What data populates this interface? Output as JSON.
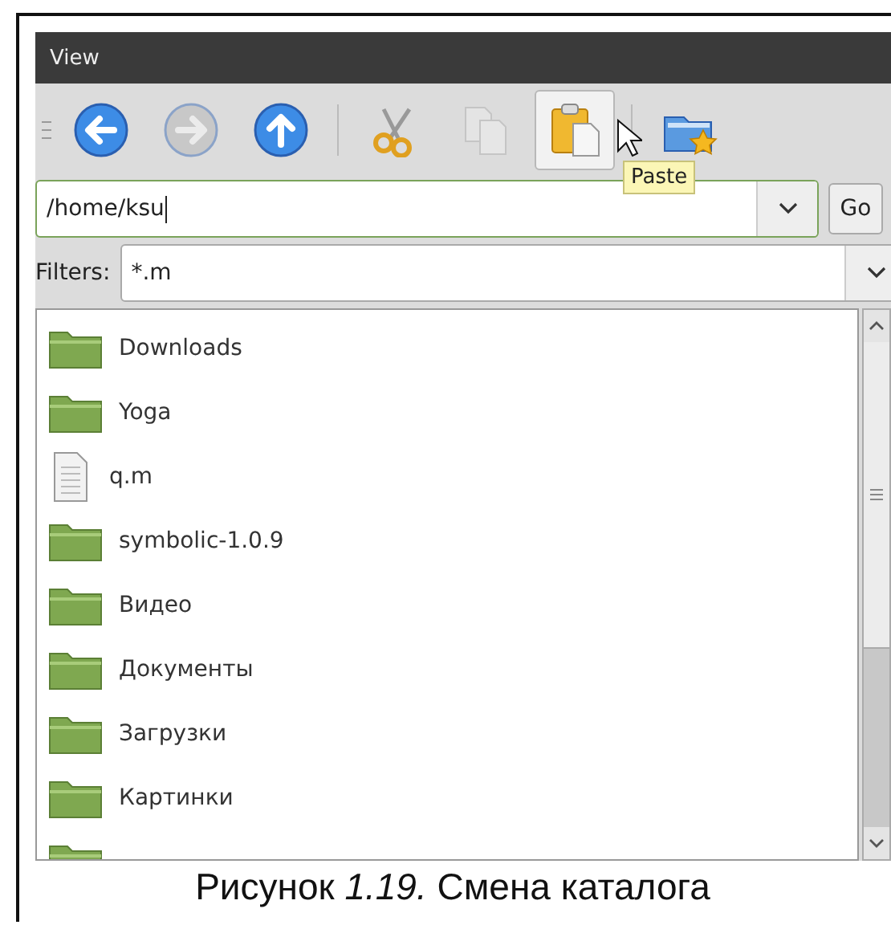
{
  "window": {
    "title": "View"
  },
  "toolbar": [
    {
      "kind": "back",
      "disabled": false,
      "hovered": false
    },
    {
      "kind": "forward",
      "disabled": true,
      "hovered": false
    },
    {
      "kind": "up",
      "disabled": false,
      "hovered": false
    },
    {
      "kind": "separator"
    },
    {
      "kind": "cut",
      "disabled": false,
      "hovered": false
    },
    {
      "kind": "copy",
      "disabled": true,
      "hovered": false
    },
    {
      "kind": "paste",
      "disabled": false,
      "hovered": true
    },
    {
      "kind": "separator"
    },
    {
      "kind": "bookmark",
      "disabled": false,
      "hovered": false
    }
  ],
  "tooltip": "Paste",
  "path": {
    "value": "/home/ksu",
    "focused": true,
    "button": "Go"
  },
  "filter": {
    "label": "Filters:",
    "value": "*.m"
  },
  "files": [
    {
      "name": "Downloads",
      "kind": "folder"
    },
    {
      "name": "Yoga",
      "kind": "folder"
    },
    {
      "name": "q.m",
      "kind": "file"
    },
    {
      "name": "symbolic-1.0.9",
      "kind": "folder"
    },
    {
      "name": "Видео",
      "kind": "folder"
    },
    {
      "name": "Документы",
      "kind": "folder"
    },
    {
      "name": "Загрузки",
      "kind": "folder"
    },
    {
      "name": "Картинки",
      "kind": "folder"
    },
    {
      "kind": "folder"
    }
  ],
  "caption": "Рисунок *1.19.* Смена каталога"
}
